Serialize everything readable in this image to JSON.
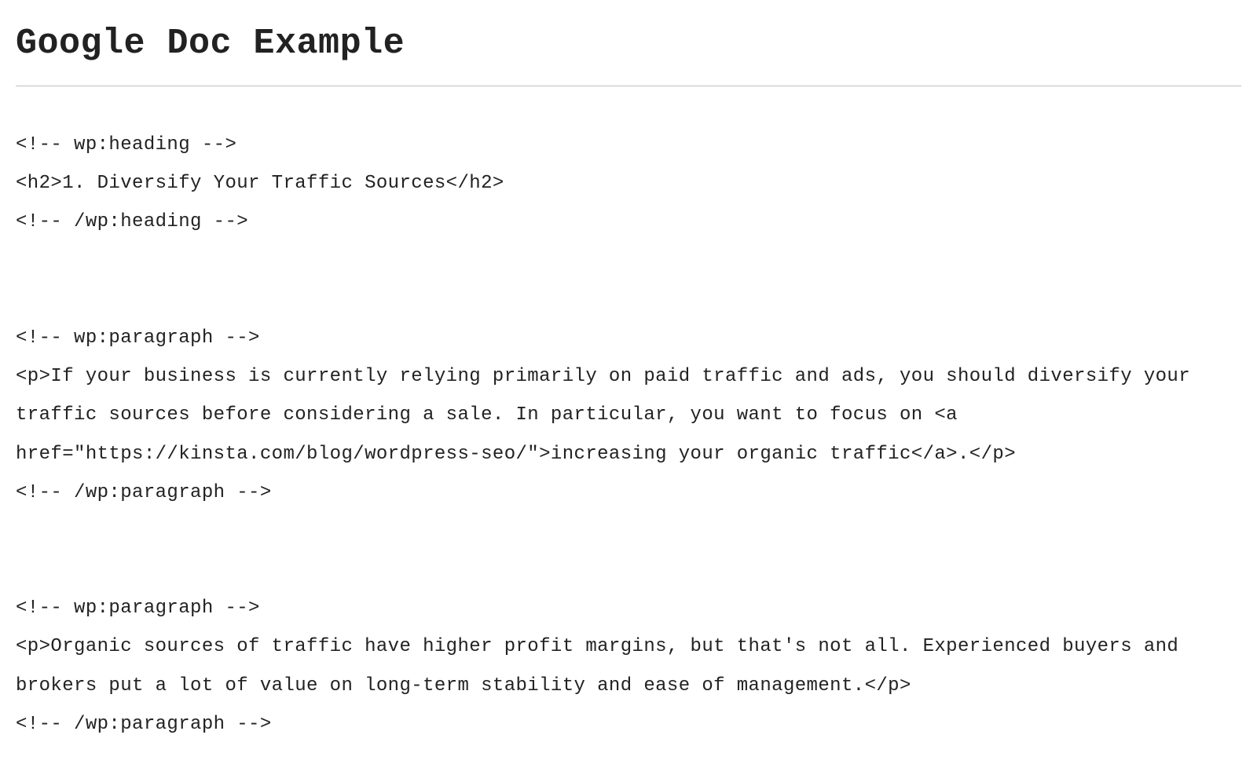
{
  "header": {
    "title": "Google Doc Example"
  },
  "code": {
    "lines": [
      "<!-- wp:heading -->",
      "<h2>1. Diversify Your Traffic Sources</h2>",
      "<!-- /wp:heading -->",
      "",
      "",
      "<!-- wp:paragraph -->",
      "<p>If your business is currently relying primarily on paid traffic and ads, you should diversify your traffic sources before considering a sale. In particular, you want to focus on <a href=\"https://kinsta.com/blog/wordpress-seo/\">increasing your organic traffic</a>.</p>",
      "<!-- /wp:paragraph -->",
      "",
      "",
      "<!-- wp:paragraph -->",
      "<p>Organic sources of traffic have higher profit margins, but that's not all. Experienced buyers and brokers put a lot of value on long-term stability and ease of management.</p>",
      "<!-- /wp:paragraph -->"
    ]
  }
}
